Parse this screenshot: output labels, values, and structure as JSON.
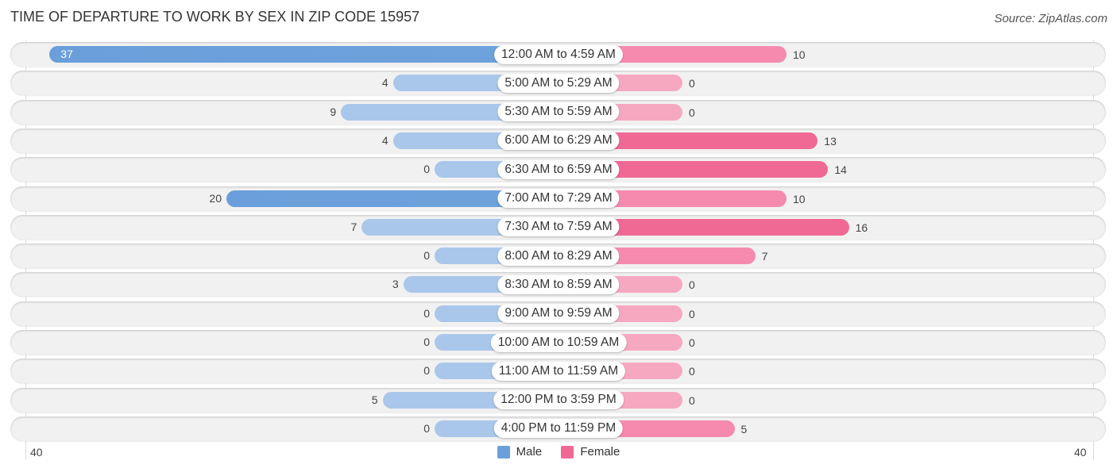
{
  "header": {
    "title": "TIME OF DEPARTURE TO WORK BY SEX IN ZIP CODE 15957",
    "source": "Source: ZipAtlas.com"
  },
  "colors": {
    "male_strong": "#6a9fdb",
    "male_light": "#a9c7ea",
    "female_strong": "#f06994",
    "female_light": "#f7a8c1"
  },
  "chart_data": {
    "type": "bar",
    "orientation": "horizontal-diverging",
    "title": "TIME OF DEPARTURE TO WORK BY SEX IN ZIP CODE 15957",
    "categories": [
      "12:00 AM to 4:59 AM",
      "5:00 AM to 5:29 AM",
      "5:30 AM to 5:59 AM",
      "6:00 AM to 6:29 AM",
      "6:30 AM to 6:59 AM",
      "7:00 AM to 7:29 AM",
      "7:30 AM to 7:59 AM",
      "8:00 AM to 8:29 AM",
      "8:30 AM to 8:59 AM",
      "9:00 AM to 9:59 AM",
      "10:00 AM to 10:59 AM",
      "11:00 AM to 11:59 AM",
      "12:00 PM to 3:59 PM",
      "4:00 PM to 11:59 PM"
    ],
    "series": [
      {
        "name": "Male",
        "values": [
          37,
          4,
          9,
          4,
          0,
          20,
          7,
          0,
          3,
          0,
          0,
          0,
          5,
          0
        ]
      },
      {
        "name": "Female",
        "values": [
          10,
          0,
          0,
          13,
          14,
          10,
          16,
          7,
          0,
          0,
          0,
          0,
          0,
          5
        ]
      }
    ],
    "axis": {
      "left_label": "40",
      "right_label": "40",
      "max": 40
    },
    "legend": {
      "position": "bottom-center",
      "items": [
        "Male",
        "Female"
      ]
    }
  }
}
